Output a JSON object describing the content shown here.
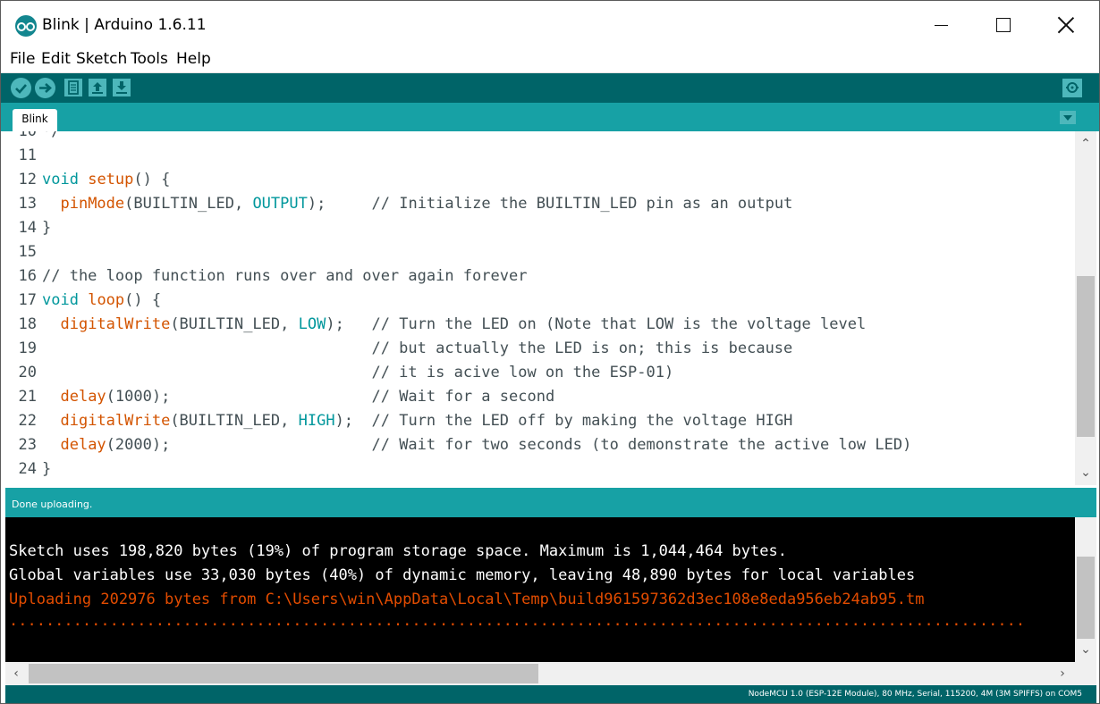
{
  "window": {
    "title": "Blink | Arduino 1.6.11"
  },
  "menu": [
    "File",
    "Edit",
    "Sketch",
    "Tools",
    "Help"
  ],
  "toolbar": {
    "icons": [
      "verify-icon",
      "upload-icon",
      "new-icon",
      "open-icon",
      "save-icon",
      "serial-monitor-icon"
    ],
    "accent": "#006468",
    "button_color": "#4db7bb"
  },
  "tabs": [
    {
      "label": "Blink"
    }
  ],
  "editor": {
    "lines": [
      {
        "n": "10",
        "text": "*/"
      },
      {
        "n": "11",
        "text": ""
      },
      {
        "n": "12",
        "text": "void setup() {"
      },
      {
        "n": "13",
        "text": "  pinMode(BUILTIN_LED, OUTPUT);     // Initialize the BUILTIN_LED pin as an output"
      },
      {
        "n": "14",
        "text": "}"
      },
      {
        "n": "15",
        "text": ""
      },
      {
        "n": "16",
        "text": "// the loop function runs over and over again forever"
      },
      {
        "n": "17",
        "text": "void loop() {"
      },
      {
        "n": "18",
        "text": "  digitalWrite(BUILTIN_LED, LOW);   // Turn the LED on (Note that LOW is the voltage level"
      },
      {
        "n": "19",
        "text": "                                    // but actually the LED is on; this is because"
      },
      {
        "n": "20",
        "text": "                                    // it is acive low on the ESP-01)"
      },
      {
        "n": "21",
        "text": "  delay(1000);                      // Wait for a second"
      },
      {
        "n": "22",
        "text": "  digitalWrite(BUILTIN_LED, HIGH);  // Turn the LED off by making the voltage HIGH"
      },
      {
        "n": "23",
        "text": "  delay(2000);                      // Wait for two seconds (to demonstrate the active low LED)"
      },
      {
        "n": "24",
        "text": "}"
      }
    ]
  },
  "status": {
    "message": "Done uploading."
  },
  "console": {
    "lines": [
      "Sketch uses 198,820 bytes (19%) of program storage space. Maximum is 1,044,464 bytes.",
      "Global variables use 33,030 bytes (40%) of dynamic memory, leaving 48,890 bytes for local variables",
      "Uploading 202976 bytes from C:\\Users\\win\\AppData\\Local\\Temp\\build961597362d3ec108e8eda956eb24ab95.tm",
      "..............................................................................................................."
    ]
  },
  "board": "NodeMCU 1.0 (ESP-12E Module), 80 MHz, Serial, 115200, 4M (3M SPIFFS) on COM5"
}
